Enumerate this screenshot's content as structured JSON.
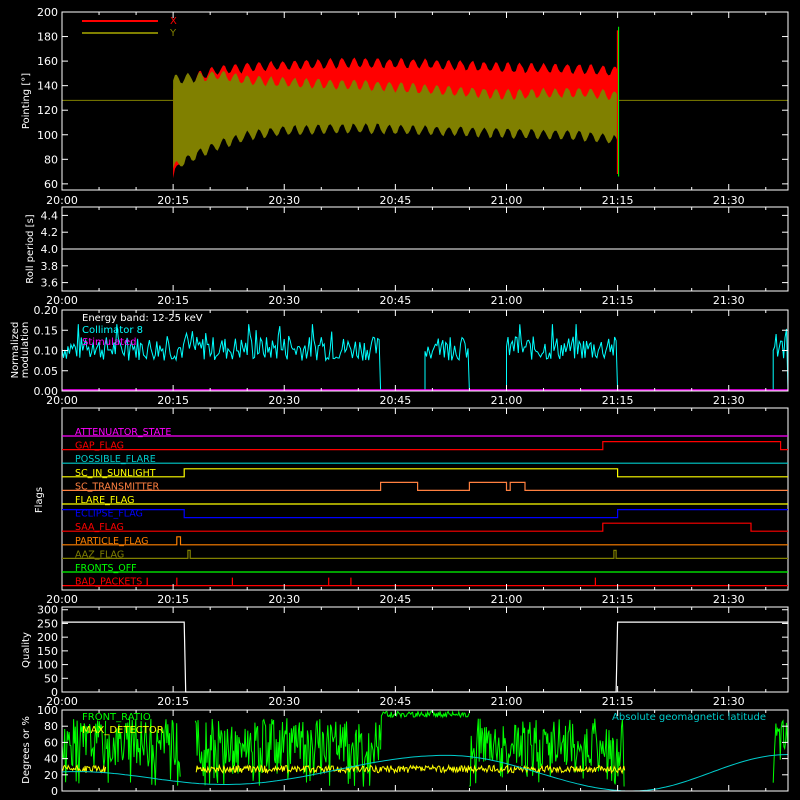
{
  "chart_data": [
    {
      "panel": "pointing",
      "type": "area",
      "ylabel": "Pointing [°]",
      "ylim": [
        55,
        200
      ],
      "yticks": [
        60,
        80,
        100,
        120,
        140,
        160,
        180,
        200
      ],
      "x_range": [
        "20:00",
        "21:38"
      ],
      "x_ticks": [
        "20:00",
        "20:15",
        "20:30",
        "20:45",
        "21:00",
        "21:15",
        "21:30"
      ],
      "baseline": 128,
      "series": [
        {
          "name": "X",
          "color": "#ff0000",
          "active_range": [
            "20:15",
            "21:15"
          ],
          "upper_envelope": [
            [
              15,
              140
            ],
            [
              18,
              150
            ],
            [
              21,
              156
            ],
            [
              25,
              158
            ],
            [
              30,
              160
            ],
            [
              40,
              162
            ],
            [
              50,
              161
            ],
            [
              60,
              158
            ],
            [
              70,
              157
            ],
            [
              75,
              155
            ]
          ],
          "lower_envelope": [
            [
              15,
              62
            ],
            [
              18,
              100
            ],
            [
              21,
              103
            ],
            [
              25,
              108
            ],
            [
              30,
              114
            ],
            [
              40,
              118
            ],
            [
              50,
              118
            ],
            [
              60,
              115
            ],
            [
              70,
              112
            ],
            [
              75,
              108
            ]
          ]
        },
        {
          "name": "Y",
          "color": "#808000",
          "active_range": [
            "20:15",
            "21:15"
          ],
          "upper_envelope": [
            [
              15,
              148
            ],
            [
              18,
              150
            ],
            [
              21,
              152
            ],
            [
              25,
              148
            ],
            [
              30,
              146
            ],
            [
              40,
              144
            ],
            [
              50,
              140
            ],
            [
              60,
              136
            ],
            [
              70,
              138
            ],
            [
              75,
              135
            ]
          ],
          "lower_envelope": [
            [
              15,
              70
            ],
            [
              18,
              80
            ],
            [
              21,
              88
            ],
            [
              25,
              96
            ],
            [
              30,
              100
            ],
            [
              40,
              102
            ],
            [
              50,
              100
            ],
            [
              60,
              98
            ],
            [
              70,
              96
            ],
            [
              75,
              92
            ]
          ]
        }
      ]
    },
    {
      "panel": "roll_period",
      "type": "line",
      "ylabel": "Roll period [s]",
      "ylim": [
        3.5,
        4.5
      ],
      "yticks": [
        3.6,
        3.8,
        4.0,
        4.2,
        4.4
      ],
      "series": [
        {
          "color": "#ffffff",
          "values": [
            [
              0,
              4.0
            ],
            [
              98,
              4.0
            ]
          ]
        }
      ]
    },
    {
      "panel": "modulation",
      "type": "line",
      "ylabel": "Normalized modulation",
      "ylim": [
        0,
        0.2
      ],
      "yticks": [
        "0.00",
        "0.05",
        "0.10",
        "0.15",
        "0.20"
      ],
      "annotation": "Energy band: 12-25 keV",
      "series": [
        {
          "name": "Collimator 8",
          "color": "#00ffff",
          "segments": [
            [
              0,
              43
            ],
            [
              49,
              55
            ],
            [
              60,
              75
            ],
            [
              96,
              98
            ]
          ],
          "mean": 0.105
        },
        {
          "name": "Stimulated",
          "color": "#ff00ff",
          "values": [
            [
              0,
              0.0
            ],
            [
              98,
              0.0
            ]
          ]
        }
      ]
    },
    {
      "panel": "flags",
      "type": "line",
      "ylabel": "Flags",
      "flags": [
        {
          "name": "ATTENUATOR_STATE",
          "color": "#ff00ff",
          "steps": [
            [
              0,
              0
            ]
          ]
        },
        {
          "name": "GAP_FLAG",
          "color": "#ff0000",
          "steps": [
            [
              0,
              0
            ],
            [
              73,
              1
            ],
            [
              97,
              0
            ]
          ]
        },
        {
          "name": "POSSIBLE_FLARE",
          "color": "#00cccc",
          "steps": [
            [
              0,
              0
            ]
          ]
        },
        {
          "name": "SC_IN_SUNLIGHT",
          "color": "#ffff00",
          "steps": [
            [
              0,
              0
            ],
            [
              16.5,
              1
            ],
            [
              75,
              0
            ]
          ]
        },
        {
          "name": "SC_TRANSMITTER",
          "color": "#ff8040",
          "steps": [
            [
              0,
              0
            ],
            [
              43,
              1
            ],
            [
              48,
              0
            ],
            [
              55,
              1
            ],
            [
              60,
              0
            ],
            [
              60.5,
              1
            ],
            [
              62.5,
              0
            ]
          ]
        },
        {
          "name": "FLARE_FLAG",
          "color": "#ffff00",
          "steps": [
            [
              0,
              0
            ]
          ]
        },
        {
          "name": "ECLIPSE_FLAG",
          "color": "#0000ff",
          "steps": [
            [
              0,
              1
            ],
            [
              16.5,
              0
            ],
            [
              75,
              1
            ]
          ]
        },
        {
          "name": "SAA_FLAG",
          "color": "#ff0000",
          "steps": [
            [
              0,
              0
            ],
            [
              73,
              1
            ],
            [
              93,
              0
            ]
          ]
        },
        {
          "name": "PARTICLE_FLAG",
          "color": "#ff8000",
          "steps": [
            [
              0,
              0
            ],
            [
              15.5,
              1
            ],
            [
              16,
              0
            ]
          ]
        },
        {
          "name": "AAZ_FLAG",
          "color": "#808000",
          "steps": [
            [
              0,
              0
            ],
            [
              17,
              1
            ],
            [
              17.3,
              0
            ],
            [
              74.5,
              1
            ],
            [
              74.8,
              0
            ]
          ]
        },
        {
          "name": "FRONTS_OFF",
          "color": "#00ff00",
          "steps": [
            [
              0,
              0
            ]
          ]
        },
        {
          "name": "BAD_PACKETS",
          "color": "#ff0000",
          "steps": [
            [
              0,
              0
            ]
          ],
          "spikes": [
            11.5,
            15.5,
            23,
            36,
            39,
            72
          ]
        }
      ]
    },
    {
      "panel": "quality",
      "type": "line",
      "ylabel": "Quality",
      "ylim": [
        0,
        310
      ],
      "yticks": [
        0,
        50,
        100,
        150,
        200,
        250,
        300
      ],
      "series": [
        {
          "color": "#ffffff",
          "values": [
            [
              0,
              255
            ],
            [
              16.5,
              255
            ],
            [
              16.7,
              0
            ],
            [
              74.8,
              0
            ],
            [
              75,
              255
            ],
            [
              98,
              255
            ]
          ]
        }
      ]
    },
    {
      "panel": "geomagnetic",
      "type": "line",
      "ylabel": "Degrees or %",
      "ylim": [
        0,
        100
      ],
      "yticks": [
        0,
        20,
        40,
        60,
        80,
        100
      ],
      "series": [
        {
          "name": "FRONT_RATIO",
          "color": "#00ff00",
          "mean": 60
        },
        {
          "name": "MAX_DETECTOR",
          "color": "#ffff00",
          "mean": 27
        },
        {
          "name": "Absolute geomagnetic latitude",
          "color": "#00cccc",
          "extrema": [
            [
              2,
              24
            ],
            [
              22,
              8
            ],
            [
              52,
              44
            ],
            [
              77,
              0
            ],
            [
              98,
              45
            ]
          ]
        }
      ]
    }
  ]
}
